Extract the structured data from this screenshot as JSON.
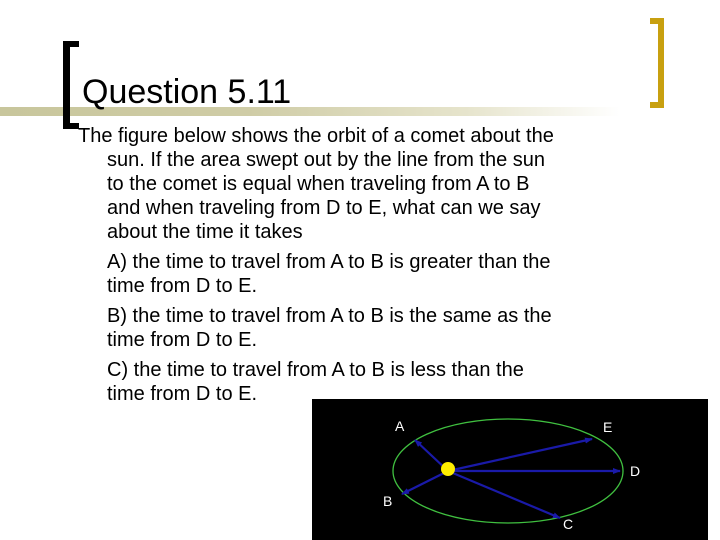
{
  "slide": {
    "title": "Question 5.11",
    "stem_first_line": "The figure below shows the orbit of a comet about the",
    "stem_rest": [
      "sun.  If the area swept out by the line from the sun",
      "to the comet is equal when traveling from A to B",
      "and when traveling from D to E, what can we say",
      "about the time it takes"
    ],
    "options": [
      {
        "line1": "A)  the time to travel from A to B is greater than the",
        "line2": "time from D to E."
      },
      {
        "line1": "B)   the time to travel from A to B is the same as the",
        "line2": "time from D to E."
      },
      {
        "line1": "C)   the time to travel from A to B is less than the",
        "line2": "time from D to E."
      }
    ]
  },
  "figure": {
    "description": "Orbit of a comet around the sun",
    "points": [
      "A",
      "B",
      "C",
      "D",
      "E"
    ],
    "colors": {
      "background": "#000000",
      "orbit": "#40c040",
      "sun": "#ffee00",
      "vectors": "#1a1aa8",
      "labels": "#ffffff"
    }
  },
  "theme": {
    "title_bar": "#c8c69c",
    "right_bracket": "#c8a010",
    "left_bracket": "#000000"
  }
}
